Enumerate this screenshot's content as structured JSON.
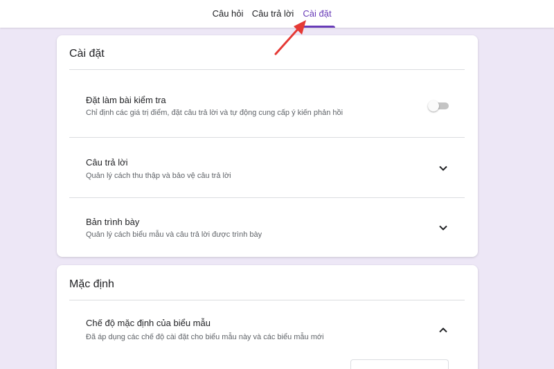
{
  "tabs": [
    {
      "label": "Câu hỏi"
    },
    {
      "label": "Câu trả lời"
    },
    {
      "label": "Cài đặt"
    }
  ],
  "settings_card": {
    "title": "Cài đặt",
    "rows": [
      {
        "title": "Đặt làm bài kiểm tra",
        "description": "Chỉ định các giá trị điểm, đặt câu trả lời và tự động cung cấp ý kiến phản hồi",
        "control": "toggle",
        "toggle_on": false
      },
      {
        "title": "Câu trả lời",
        "description": "Quản lý cách thu thập và bảo vệ câu trả lời",
        "control": "chevron-down"
      },
      {
        "title": "Bản trình bày",
        "description": "Quản lý cách biểu mẫu và câu trả lời được trình bày",
        "control": "chevron-down"
      }
    ]
  },
  "defaults_card": {
    "title": "Mặc định",
    "rows": [
      {
        "title": "Chế độ mặc định của biểu mẫu",
        "description": "Đã áp dụng các chế độ cài đặt cho biểu mẫu này và các biểu mẫu mới",
        "control": "chevron-up"
      }
    ]
  },
  "colors": {
    "accent": "#673ab7",
    "background": "#ede7f6",
    "annotation_arrow": "#e53935"
  },
  "icons": [
    "chevron-down-icon",
    "chevron-up-icon",
    "annotation-arrow-icon"
  ]
}
